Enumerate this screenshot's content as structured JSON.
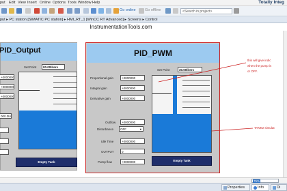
{
  "menubar": {
    "items": [
      "put",
      "Edit",
      "View",
      "Insert",
      "Online",
      "Options",
      "Tools",
      "Window",
      "Help"
    ],
    "brand": "Totally Integ"
  },
  "toolbar": {
    "go_online": "Go online",
    "go_offline": "Go offline",
    "search_placeholder": "<Search in project>"
  },
  "breadcrumb": {
    "text": "put  ▸  PC station [SIMATIC PC station]  ▸  HMI_RT_1 [WinCC RT Advanced]  ▸  Screens  ▸  Control"
  },
  "watermark": "InstrumentationTools.com",
  "left_panel": {
    "title": "PID_Output",
    "set_point_label": "Set Point",
    "set_point_value": "00.00liters",
    "fields": [
      "+0000000",
      "+0000000",
      "+0000000"
    ],
    "rate_value": "000.0l/sec",
    "button": "Empty Tank"
  },
  "main_panel": {
    "title": "PID_PWM",
    "set_point_label": "Set Point",
    "set_point_value": "30.00liters",
    "rows": [
      {
        "label": "Proportional gain",
        "value": "+0000000"
      },
      {
        "label": "Integral gain",
        "value": "+0000000"
      },
      {
        "label": "Derivative gain",
        "value": "+0000000"
      },
      {
        "label": "Outflow",
        "value": "+0000000"
      },
      {
        "label": "Disturbance",
        "value": "OFF"
      },
      {
        "label": "Idle Time",
        "value": "+0000000"
      },
      {
        "label": "OUTPUT",
        "value": "0"
      },
      {
        "label": "Pump flow",
        "value": "+0000000"
      }
    ],
    "button": "Empty Tank",
    "tank_level_fraction": 0.5
  },
  "annotations": {
    "note_line1": "this will give indic",
    "note_line2": "when the pump is",
    "note_line3": "or OFF.",
    "tank_note": "TANK2 simulat"
  },
  "zoom": {
    "value": "75%"
  },
  "bottom_tabs": {
    "properties": "Properties",
    "info": "Info",
    "diagnostics": "Di"
  },
  "colors": {
    "header_blue": "#9ccaf0",
    "water_blue": "#1a7ad8",
    "panel_grey": "#c8c8c8",
    "button_navy": "#1f2e6b",
    "annotation_red": "#cc2222"
  }
}
